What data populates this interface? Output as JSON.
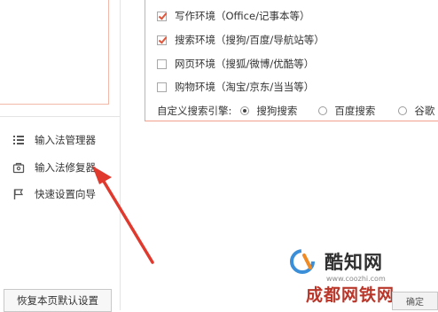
{
  "left": {
    "tools": [
      {
        "label": "输入法管理器",
        "icon": "list-icon"
      },
      {
        "label": "输入法修复器",
        "icon": "toolbox-icon"
      },
      {
        "label": "快速设置向导",
        "icon": "flag-icon"
      }
    ],
    "restore_label": "恢复本页默认设置"
  },
  "options": [
    {
      "label": "写作环境（Office/记事本等）",
      "checked": true
    },
    {
      "label": "搜索环境（搜狗/百度/导航站等）",
      "checked": true
    },
    {
      "label": "网页环境（搜狐/微博/优酷等）",
      "checked": false
    },
    {
      "label": "购物环境（淘宝/京东/当当等）",
      "checked": false
    }
  ],
  "engine": {
    "label": "自定义搜索引擎:",
    "choices": [
      "搜狗搜索",
      "百度搜索",
      "谷歌"
    ],
    "selected": 0
  },
  "confirm_label": "确定",
  "watermarks": {
    "brand": "酷知网",
    "url": "www.coozhi.com",
    "brand2": "成都网铁网",
    "sub": "Ξ"
  },
  "colors": {
    "accent": "#e0553a",
    "arrow": "#e03a2f",
    "border_accent": "#f0a08c"
  }
}
